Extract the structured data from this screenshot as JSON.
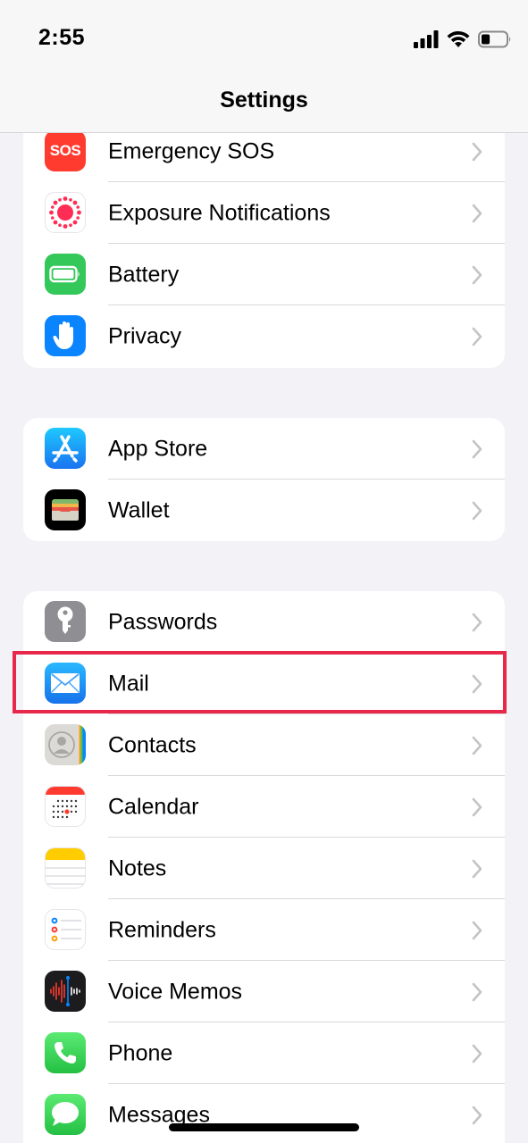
{
  "status_bar": {
    "time": "2:55",
    "icons": [
      "cellular-signal-icon",
      "wifi-icon",
      "battery-icon"
    ],
    "battery_level": 0.35
  },
  "header": {
    "title": "Settings"
  },
  "groups": [
    {
      "items": [
        {
          "label": "Emergency SOS",
          "icon": "sos-icon",
          "icon_text": "SOS",
          "icon_color": "#ff3b30"
        },
        {
          "label": "Exposure Notifications",
          "icon": "exposure-notifications-icon",
          "icon_color": "#ff2d55"
        },
        {
          "label": "Battery",
          "icon": "battery-settings-icon",
          "icon_color": "#34c759"
        },
        {
          "label": "Privacy",
          "icon": "privacy-hand-icon",
          "icon_color": "#0a84ff"
        }
      ]
    },
    {
      "items": [
        {
          "label": "App Store",
          "icon": "app-store-icon",
          "icon_color": "#0a84ff"
        },
        {
          "label": "Wallet",
          "icon": "wallet-icon",
          "icon_color": "#000000"
        }
      ]
    },
    {
      "items": [
        {
          "label": "Passwords",
          "icon": "key-icon",
          "icon_color": "#8e8e93"
        },
        {
          "label": "Mail",
          "icon": "mail-envelope-icon",
          "icon_color": "#1e90ff",
          "highlighted": true
        },
        {
          "label": "Contacts",
          "icon": "contacts-icon",
          "icon_color": "#d1d1d6"
        },
        {
          "label": "Calendar",
          "icon": "calendar-icon",
          "icon_color": "#ffffff"
        },
        {
          "label": "Notes",
          "icon": "notes-icon",
          "icon_color": "#ffcc00"
        },
        {
          "label": "Reminders",
          "icon": "reminders-icon",
          "icon_color": "#ffffff"
        },
        {
          "label": "Voice Memos",
          "icon": "voice-memos-icon",
          "icon_color": "#000000"
        },
        {
          "label": "Phone",
          "icon": "phone-icon",
          "icon_color": "#34c759"
        },
        {
          "label": "Messages",
          "icon": "messages-icon",
          "icon_color": "#34c759"
        }
      ]
    }
  ],
  "colors": {
    "highlight": "#e8284a",
    "background": "#f2f2f7"
  }
}
